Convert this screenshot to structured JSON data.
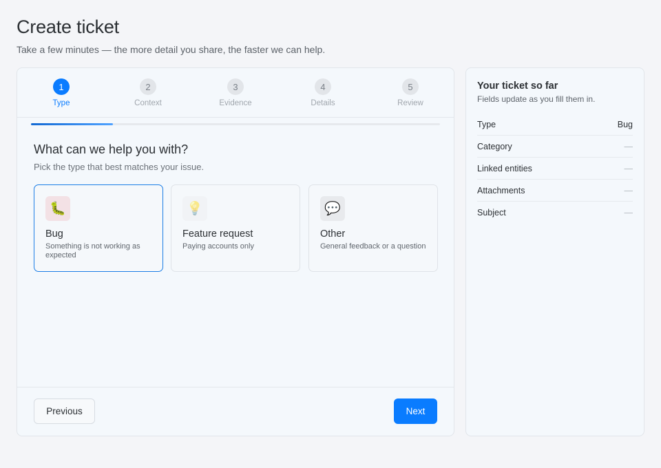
{
  "header": {
    "title": "Create ticket",
    "subtitle": "Take a few minutes — the more detail you share, the faster we can help."
  },
  "steps": [
    {
      "num": "1",
      "label": "Type"
    },
    {
      "num": "2",
      "label": "Context"
    },
    {
      "num": "3",
      "label": "Evidence"
    },
    {
      "num": "4",
      "label": "Details"
    },
    {
      "num": "5",
      "label": "Review"
    }
  ],
  "active_step": 1,
  "progress": 0.2,
  "section": {
    "title": "What can we help you with?",
    "subtitle": "Pick the type that best matches your issue."
  },
  "types": [
    {
      "icon": "bug-icon",
      "glyph": "🐛",
      "name": "Bug",
      "desc": "Something is not working as expected",
      "selected": true
    },
    {
      "icon": "lightbulb-icon",
      "glyph": "💡",
      "name": "Feature request",
      "desc": "Paying accounts only",
      "selected": false
    },
    {
      "icon": "speech-bubble-icon",
      "glyph": "💬",
      "name": "Other",
      "desc": "General feedback or a question",
      "selected": false
    }
  ],
  "footer": {
    "previous_label": "Previous",
    "next_label": "Next"
  },
  "summary": {
    "title": "Your ticket so far",
    "subtitle": "Fields update as you fill them in.",
    "rows": [
      {
        "key": "Type",
        "value": "Bug"
      },
      {
        "key": "Category",
        "value": "—"
      },
      {
        "key": "Linked entities",
        "value": "—"
      },
      {
        "key": "Attachments",
        "value": "—"
      },
      {
        "key": "Subject",
        "value": "—"
      }
    ]
  },
  "colors": {
    "accent": "#0a7cff",
    "selected_border": "#1a7de6",
    "page_bg": "#f4f5f8"
  }
}
